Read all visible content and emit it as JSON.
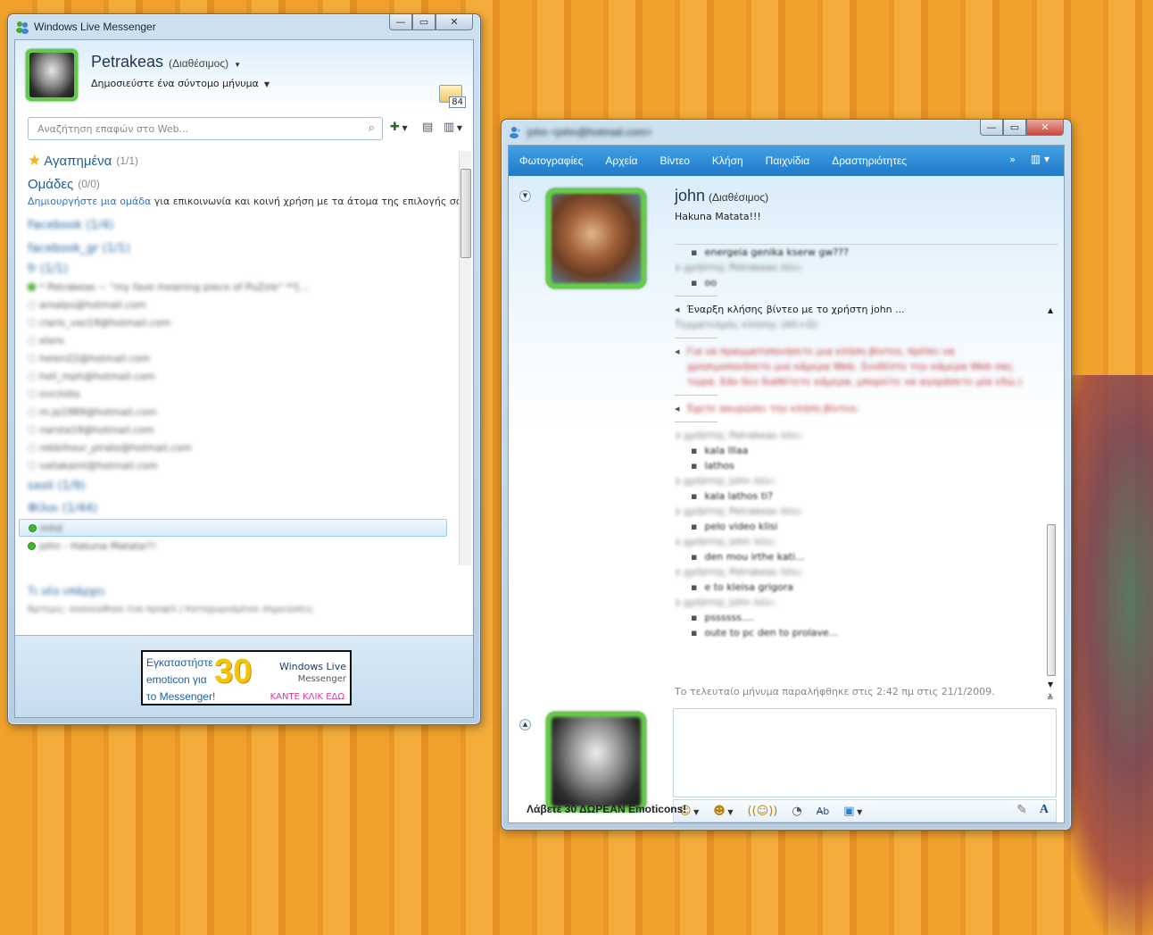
{
  "messenger": {
    "title": "Windows Live Messenger",
    "caption": {
      "minimize": "—",
      "maximize": "▭",
      "close": "✕"
    },
    "user": {
      "name": "Petrakeas",
      "status": "(Διαθέσιμος)",
      "personal_message": "Δημοσιεύστε ένα σύντομο μήνυμα"
    },
    "mail_count": "84",
    "search_placeholder": "Αναζήτηση επαφών στο Web...",
    "groups": {
      "favorites": {
        "label": "Αγαπημένα",
        "count": "(1/1)"
      },
      "groups": {
        "label": "Ομάδες",
        "count": "(0/0)"
      }
    },
    "create_group": {
      "link": "Δημιουργήστε μια ομάδα",
      "text": " για επικοινωνία και κοινή χρήση με τα άτομα της επιλογής σας"
    },
    "contact_rows": [
      "Facebook (1/4)",
      "facebook_gr (1/1)",
      "fr (1/1)",
      "* Petrakeas ~ \"my fave meaning piece of PuZzle\" **[...",
      "aroalps@hotmail.com",
      "claris_vaz19@hotmail.com",
      "elero",
      "helen22@hotmail.com",
      "heli_mph@hotmail.com",
      "mrchillis",
      "m.ja1989@hotmail.com",
      "narsta19@hotmail.com",
      "rebbihour_pirate@hotmail.com",
      "valiakaint@hotmail.com",
      "sxoli (1/9)",
      "Φίλοι (1/44)",
      "mhd",
      "john - Hakuna Matata!!!"
    ],
    "whats_new": "Τι νέο υπάρχει",
    "whats_new_line": "Άρτεμις: ανανεώθηκε ένα προφίλ | Καταχωρισμένοι σημειώσεις",
    "ad": {
      "line1": "Εγκαταστήστε",
      "line2": "emoticon για",
      "line3": "το Messenger!",
      "number": "30",
      "brand": "Windows Live",
      "product": "Messenger",
      "cta": "ΚΑΝΤΕ ΚΛΙΚ ΕΔΩ"
    }
  },
  "conversation": {
    "title": "john <john@hotmail.com>",
    "caption": {
      "minimize": "—",
      "maximize": "▭",
      "close": "✕"
    },
    "menu": [
      "Φωτογραφίες",
      "Αρχεία",
      "Βίντεο",
      "Κλήση",
      "Παιχνίδια",
      "Δραστηριότητες"
    ],
    "more": "»",
    "contact": {
      "name": "john",
      "status": "(Διαθέσιμος)",
      "message": "Hakuna Matata!!!"
    },
    "history": [
      {
        "type": "ind",
        "text": "energeia genika kserw gw???"
      },
      {
        "type": "who",
        "text": "ο χρήστης Petrakeas λέει:"
      },
      {
        "type": "ind",
        "text": "oo"
      },
      {
        "type": "sep"
      },
      {
        "type": "sys",
        "text": "Έναρξη κλήσης βίντεο με το χρήστη john ..."
      },
      {
        "type": "gray",
        "text": "Τερματισμός κλήσης (Alt+Q)"
      },
      {
        "type": "sep"
      },
      {
        "type": "red",
        "text": "Για να πραγματοποιήσετε μια κλήση βίντεο, πρέπει να"
      },
      {
        "type": "red2",
        "text": "χρησιμοποιήσετε μια κάμερα Web. Συνδέστε την κάμερα Web σας"
      },
      {
        "type": "red2",
        "text": "τώρα. Εάν δεν διαθέτετε κάμερα, μπορείτε να αγοράσετε μία εδώ.)"
      },
      {
        "type": "sep"
      },
      {
        "type": "red",
        "text": "Έχετε ακυρώσει την κλήση βίντεο."
      },
      {
        "type": "sep"
      },
      {
        "type": "who",
        "text": "ο χρήστης Petrakeas λέει:"
      },
      {
        "type": "ind",
        "text": "kala lllaa"
      },
      {
        "type": "ind",
        "text": "lathos"
      },
      {
        "type": "who",
        "text": "ο χρήστης john λέει:"
      },
      {
        "type": "ind",
        "text": "kala lathos ti?"
      },
      {
        "type": "who",
        "text": "ο χρήστης Petrakeas λέει:"
      },
      {
        "type": "ind",
        "text": "pelo video klisi"
      },
      {
        "type": "who",
        "text": "ο χρήστης john λέει:"
      },
      {
        "type": "ind",
        "text": "den mou irthe kati..."
      },
      {
        "type": "who",
        "text": "ο χρήστης Petrakeas λέει:"
      },
      {
        "type": "ind",
        "text": "e to kleisa grigora"
      },
      {
        "type": "who",
        "text": "ο χρήστης john λέει:"
      },
      {
        "type": "ind",
        "text": "pssssss...."
      },
      {
        "type": "ind",
        "text": "oute to pc den to prolave..."
      }
    ],
    "last_message": "Το τελευταίο μήνυμα παραλήφθηκε στις 2:42 πμ στις 21/1/2009.",
    "promo": "Λάβετε 30 ΔΩΡΕΑΝ Emoticons!"
  }
}
